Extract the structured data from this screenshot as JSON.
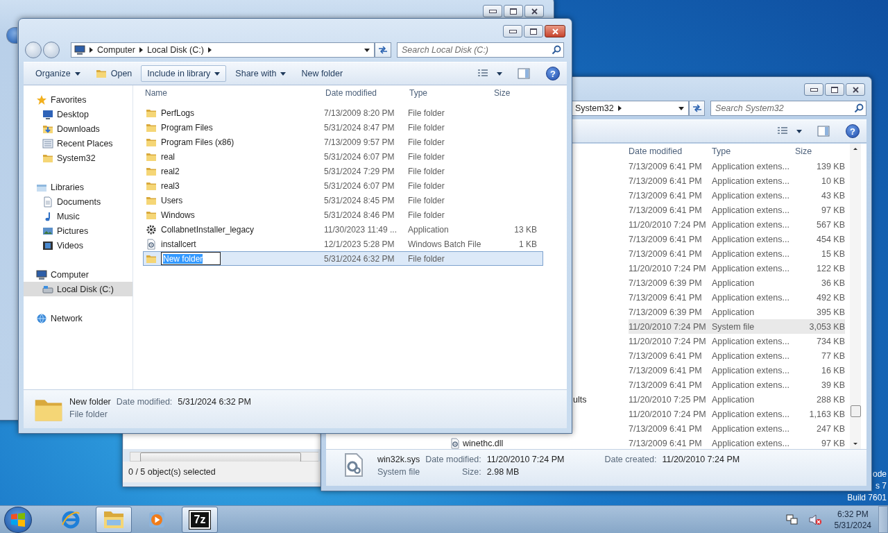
{
  "desktop": {
    "watermark": [
      "ode",
      "s 7",
      "Build 7601"
    ]
  },
  "back_window": {
    "status_bar": "0 / 5 object(s) selected"
  },
  "system32_window": {
    "address": [
      "System32"
    ],
    "search": {
      "placeholder": "Search System32"
    },
    "help": "?",
    "columns": [
      "Date modified",
      "Type",
      "Size"
    ],
    "rows": [
      {
        "date": "7/13/2009 6:41 PM",
        "type": "Application extens...",
        "size": "139 KB",
        "selected": false
      },
      {
        "date": "7/13/2009 6:41 PM",
        "type": "Application extens...",
        "size": "10 KB",
        "selected": false
      },
      {
        "date": "7/13/2009 6:41 PM",
        "type": "Application extens...",
        "size": "43 KB",
        "selected": false
      },
      {
        "date": "7/13/2009 6:41 PM",
        "type": "Application extens...",
        "size": "97 KB",
        "selected": false
      },
      {
        "date": "11/20/2010 7:24 PM",
        "type": "Application extens...",
        "size": "567 KB",
        "selected": false
      },
      {
        "date": "7/13/2009 6:41 PM",
        "type": "Application extens...",
        "size": "454 KB",
        "selected": false
      },
      {
        "date": "7/13/2009 6:41 PM",
        "type": "Application extens...",
        "size": "15 KB",
        "selected": false
      },
      {
        "date": "11/20/2010 7:24 PM",
        "type": "Application extens...",
        "size": "122 KB",
        "selected": false
      },
      {
        "date": "7/13/2009 6:39 PM",
        "type": "Application",
        "size": "36 KB",
        "selected": false
      },
      {
        "date": "7/13/2009 6:41 PM",
        "type": "Application extens...",
        "size": "492 KB",
        "selected": false
      },
      {
        "date": "7/13/2009 6:39 PM",
        "type": "Application",
        "size": "395 KB",
        "selected": false
      },
      {
        "date": "11/20/2010 7:24 PM",
        "type": "System file",
        "size": "3,053 KB",
        "selected": true
      },
      {
        "date": "11/20/2010 7:24 PM",
        "type": "Application extens...",
        "size": "734 KB",
        "selected": false
      },
      {
        "date": "7/13/2009 6:41 PM",
        "type": "Application extens...",
        "size": "77 KB",
        "selected": false
      },
      {
        "date": "7/13/2009 6:41 PM",
        "type": "Application extens...",
        "size": "16 KB",
        "selected": false
      },
      {
        "date": "7/13/2009 6:41 PM",
        "type": "Application extens...",
        "size": "39 KB",
        "selected": false
      },
      {
        "name_end": "ults",
        "date": "11/20/2010 7:25 PM",
        "type": "Application",
        "size": "288 KB",
        "selected": false
      },
      {
        "date": "11/20/2010 7:24 PM",
        "type": "Application extens...",
        "size": "1,163 KB",
        "selected": false
      },
      {
        "date": "7/13/2009 6:41 PM",
        "type": "Application extens...",
        "size": "247 KB",
        "selected": false
      },
      {
        "name": "winethc.dll",
        "date": "7/13/2009 6:41 PM",
        "type": "Application extens...",
        "size": "97 KB",
        "selected": false
      }
    ],
    "details": {
      "name": "win32k.sys",
      "type": "System file",
      "modified_label": "Date modified:",
      "modified": "11/20/2010 7:24 PM",
      "size_label": "Size:",
      "size": "2.98 MB",
      "created_label": "Date created:",
      "created": "11/20/2010 7:24 PM"
    }
  },
  "main_window": {
    "address": [
      "Computer",
      "Local Disk (C:)"
    ],
    "search": {
      "placeholder": "Search Local Disk (C:)"
    },
    "help": "?",
    "toolbar": [
      {
        "label": "Organize",
        "kind": "menu",
        "hovered": false
      },
      {
        "label": "Open",
        "kind": "open",
        "hovered": false
      },
      {
        "label": "Include in library",
        "kind": "menu",
        "hovered": true
      },
      {
        "label": "Share with",
        "kind": "menu",
        "hovered": false
      },
      {
        "label": "New folder",
        "kind": "button",
        "hovered": false
      }
    ],
    "nav": [
      {
        "label": "Favorites",
        "kind": "star",
        "selected": false,
        "children": [
          {
            "label": "Desktop",
            "kind": "desktop",
            "selected": false
          },
          {
            "label": "Downloads",
            "kind": "downloads",
            "selected": false
          },
          {
            "label": "Recent Places",
            "kind": "recent",
            "selected": false
          },
          {
            "label": "System32",
            "kind": "folder",
            "selected": false
          }
        ]
      },
      {
        "label": "Libraries",
        "kind": "library",
        "selected": false,
        "children": [
          {
            "label": "Documents",
            "kind": "documents",
            "selected": false
          },
          {
            "label": "Music",
            "kind": "music",
            "selected": false
          },
          {
            "label": "Pictures",
            "kind": "pictures",
            "selected": false
          },
          {
            "label": "Videos",
            "kind": "videos",
            "selected": false
          }
        ]
      },
      {
        "label": "Computer",
        "kind": "computer",
        "selected": false,
        "children": [
          {
            "label": "Local Disk (C:)",
            "kind": "drive",
            "selected": true
          }
        ]
      },
      {
        "label": "Network",
        "kind": "network",
        "selected": false
      }
    ],
    "columns": [
      "Name",
      "Date modified",
      "Type",
      "Size"
    ],
    "rows": [
      {
        "name": "PerfLogs",
        "kind": "folder",
        "date": "7/13/2009 8:20 PM",
        "type": "File folder",
        "selected": false,
        "editing": false
      },
      {
        "name": "Program Files",
        "kind": "folder",
        "date": "5/31/2024 8:47 PM",
        "type": "File folder",
        "selected": false,
        "editing": false
      },
      {
        "name": "Program Files (x86)",
        "kind": "folder",
        "date": "7/13/2009 9:57 PM",
        "type": "File folder",
        "selected": false,
        "editing": false
      },
      {
        "name": "real",
        "kind": "folder",
        "date": "5/31/2024 6:07 PM",
        "type": "File folder",
        "selected": false,
        "editing": false
      },
      {
        "name": "real2",
        "kind": "folder",
        "date": "5/31/2024 7:29 PM",
        "type": "File folder",
        "selected": false,
        "editing": false
      },
      {
        "name": "real3",
        "kind": "folder",
        "date": "5/31/2024 6:07 PM",
        "type": "File folder",
        "selected": false,
        "editing": false
      },
      {
        "name": "Users",
        "kind": "folder",
        "date": "5/31/2024 8:45 PM",
        "type": "File folder",
        "selected": false,
        "editing": false
      },
      {
        "name": "Windows",
        "kind": "folder",
        "date": "5/31/2024 8:46 PM",
        "type": "File folder",
        "selected": false,
        "editing": false
      },
      {
        "name": "CollabnetInstaller_legacy",
        "kind": "application",
        "date": "11/30/2023 11:49 ...",
        "type": "Application",
        "size": "13 KB",
        "selected": false,
        "editing": false
      },
      {
        "name": "installcert",
        "kind": "batch",
        "date": "12/1/2023 5:28 PM",
        "type": "Windows Batch File",
        "size": "1 KB",
        "selected": false,
        "editing": false
      },
      {
        "name": "New folder",
        "kind": "folder",
        "date": "5/31/2024 6:32 PM",
        "type": "File folder",
        "selected": true,
        "editing": true
      }
    ],
    "details": {
      "name": "New folder",
      "modified_label": "Date modified:",
      "modified": "5/31/2024 6:32 PM",
      "type": "File folder"
    }
  },
  "taskbar": {
    "items": [
      {
        "kind": "start"
      },
      {
        "kind": "browser",
        "running": false
      },
      {
        "kind": "explorer",
        "running": true
      },
      {
        "kind": "media",
        "running": false
      },
      {
        "kind": "archiver",
        "label": "7z",
        "running": true
      }
    ],
    "clock": {
      "time": "6:32 PM",
      "date": "5/31/2024"
    }
  }
}
